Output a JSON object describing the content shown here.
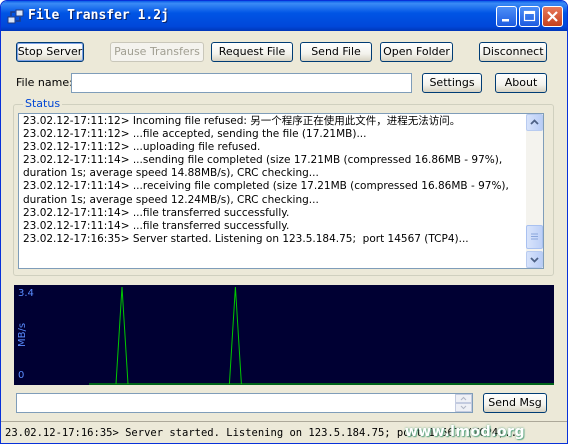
{
  "window": {
    "title": "File Transfer 1.2j",
    "icon": "transfer-icon",
    "controls": [
      "minimize-icon",
      "maximize-icon",
      "close-icon"
    ]
  },
  "toolbar": {
    "stop_server": "Stop Server",
    "pause_transfers": "Pause Transfers",
    "request_file": "Request File",
    "send_file": "Send File",
    "open_folder": "Open Folder",
    "disconnect": "Disconnect"
  },
  "filename": {
    "label": "File name:",
    "value": "",
    "settings": "Settings",
    "about": "About"
  },
  "status": {
    "legend": "Status",
    "lines": [
      "23.02.12-17:11:12> Incoming file refused: 另一个程序正在使用此文件，进程无法访问。",
      "23.02.12-17:11:12> ...file accepted, sending the file (17.21MB)...",
      "23.02.12-17:11:12> ...uploading file refused.",
      "23.02.12-17:11:14> ...sending file completed (size 17.21MB (compressed 16.86MB - 97%), duration 1s; average speed 14.88MB/s), CRC checking...",
      "23.02.12-17:11:14> ...receiving file completed (size 17.21MB (compressed 16.86MB - 97%), duration 1s; average speed 12.24MB/s), CRC checking...",
      "23.02.12-17:11:14> ...file transferred successfully.",
      "23.02.12-17:11:14> ...file transferred successfully.",
      "23.02.12-17:16:35> Server started. Listening on 123.5.184.75;  port 14567 (TCP4)..."
    ]
  },
  "graph": {
    "y_max_label": "3.4",
    "y_min_label": "0",
    "unit_label": "MB/s",
    "line_color": "#00c800",
    "background": "#000033",
    "spikes": [
      {
        "position": 0.2,
        "value": 3.4
      },
      {
        "position": 0.41,
        "value": 3.4
      }
    ]
  },
  "message": {
    "value": "",
    "send_label": "Send Msg"
  },
  "statusbar": {
    "text": "23.02.12-17:16:35> Server started. Listening on 123.5.184.75;  port 14567 (TCP4)...",
    "watermark": "www.lmod.org"
  },
  "colors": {
    "title_bar": "#0055e5",
    "status_legend": "#0046d5",
    "window_bg": "#ece9d8"
  }
}
